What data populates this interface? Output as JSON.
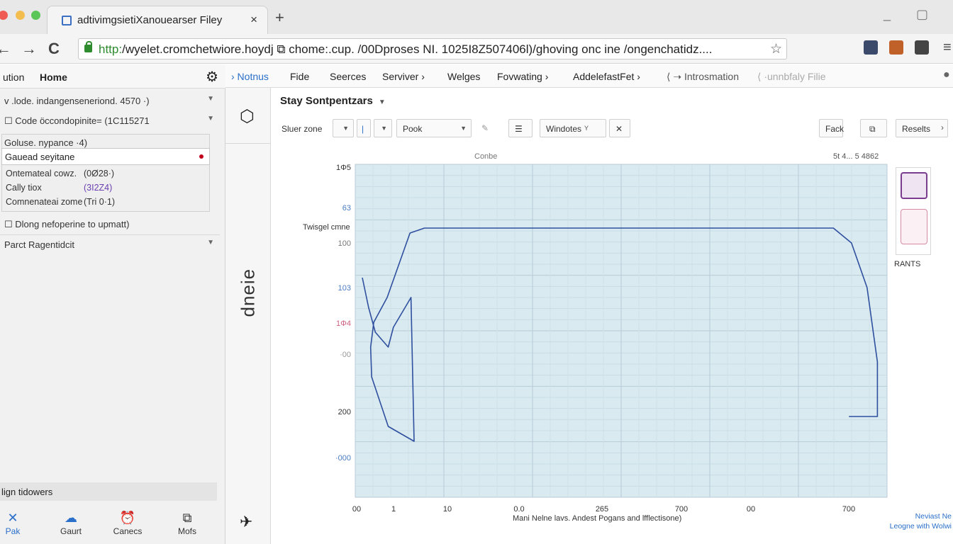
{
  "browser": {
    "tab_title": "adtivimgsietiXanouearser Filey",
    "tab_close": "×",
    "new_tab": "+",
    "url_scheme": "http:",
    "url_rest": "/wyelet.cromchetwiore.hoydj ⧉ chome:.cup. /00Dproses NI. 1025I8Z507406l)/ghoving onc ine /ongenchatidz....",
    "back": "←",
    "forward": "→",
    "reload": "C",
    "star": "☆",
    "menu": "≡",
    "minimize": "_",
    "maximize": "▢",
    "icons": [
      "back-icon",
      "forward-icon",
      "reload-icon",
      "lock-icon",
      "star-icon",
      "extension-icon",
      "menu-icon"
    ]
  },
  "sidebar": {
    "head_left": "ution",
    "head_title": "Home",
    "gear": "⚙",
    "rows": [
      {
        "text": "v .lode. indangenseneriond. 4570 ·)"
      },
      {
        "text": "☐ Code öccondopinite= (1C115271"
      },
      {
        "text": "Goluse. nypance ·4)"
      }
    ],
    "input_value": "Gauead seyitane",
    "stats": [
      {
        "label": "Ontemateal cowz.",
        "value": "(0Ø28·)"
      },
      {
        "label": "Cally tiox",
        "value": "(3I2Z4)"
      },
      {
        "label": "Comnenateai zome",
        "value": "(Tri 0·1)"
      }
    ],
    "checkbox_row": "☐ Dlong nefoperine to upmatt)",
    "parent_row": "Parct Ragentidcit",
    "bottom_row": "lign tidowers",
    "nav": [
      {
        "label": "Pak",
        "icon": "x-icon",
        "glyph": "✕"
      },
      {
        "label": "Gaurt",
        "icon": "cloud-icon",
        "glyph": "☁"
      },
      {
        "label": "Canecs",
        "icon": "alarm-icon",
        "glyph": "⏰"
      },
      {
        "label": "Mofs",
        "icon": "window-icon",
        "glyph": "⧉"
      }
    ]
  },
  "menubar": {
    "items": [
      "› Notnus",
      "Fide",
      "Seerces",
      "Serviver ›",
      "Welges",
      "Fovwating ›",
      "AddelefastFet ›",
      "⟨ ➝ Introsmation",
      "⟨ ·unnbfaly Filie"
    ]
  },
  "vstrip": {
    "hex": "⬡",
    "vertical_text": "dneie",
    "plane": "✈"
  },
  "panel": {
    "title": "Stay Sontpentzars",
    "filter_label": "Sluer zone",
    "pook_label": "Pook",
    "windotes_label": "Windotes",
    "funnel": "Y",
    "close": "✕",
    "pack_button": "Fack",
    "copy_icon": "⧉",
    "resets_button": "Reselts",
    "thumbs_label": "RANTS",
    "legend_note_1": "Neviast Ne",
    "legend_note_2": "Leogne with Wolwi"
  },
  "chart_data": {
    "type": "line",
    "title": "Conbe",
    "top_right_label": "5t 4... 5 4862",
    "ylabel": "Twisgel cmne",
    "xlabel": "Mani Nelne lavs. Andest Pogans and lfflectisone)",
    "y_ticks": [
      {
        "label": "1Φ5",
        "color": "#333333"
      },
      {
        "label": "63",
        "color": "#4a7cc4"
      },
      {
        "label": "100",
        "color": "#777777"
      },
      {
        "label": "103",
        "color": "#4a7cc4"
      },
      {
        "label": "1Φ4",
        "color": "#d06080"
      },
      {
        "label": "·00",
        "color": "#999999"
      },
      {
        "label": "200",
        "color": "#333333"
      },
      {
        "label": "·000",
        "color": "#4a7cc4"
      }
    ],
    "x_ticks": [
      "00",
      "1",
      "10",
      "0.0",
      "265",
      "700",
      "00",
      "700"
    ],
    "series": [
      {
        "values": [
          [
            0.0,
            0.9
          ],
          [
            0.012,
            0.84
          ],
          [
            0.025,
            0.79
          ],
          [
            0.05,
            0.76
          ],
          [
            0.06,
            0.8
          ],
          [
            0.094,
            0.86
          ],
          [
            0.1,
            0.57
          ],
          [
            0.05,
            0.6
          ],
          [
            0.018,
            0.7
          ],
          [
            0.016,
            0.76
          ],
          [
            0.022,
            0.81
          ],
          [
            0.048,
            0.86
          ],
          [
            0.092,
            0.99
          ],
          [
            0.12,
            1.0
          ],
          [
            0.4,
            1.0
          ],
          [
            0.7,
            1.0
          ],
          [
            0.91,
            1.0
          ],
          [
            0.945,
            0.97
          ],
          [
            0.975,
            0.88
          ],
          [
            0.995,
            0.73
          ],
          [
            0.995,
            0.62
          ],
          [
            0.94,
            0.62
          ]
        ]
      }
    ],
    "grid": true,
    "background": "#d9eaf1",
    "line_color": "#2f4f9f"
  }
}
